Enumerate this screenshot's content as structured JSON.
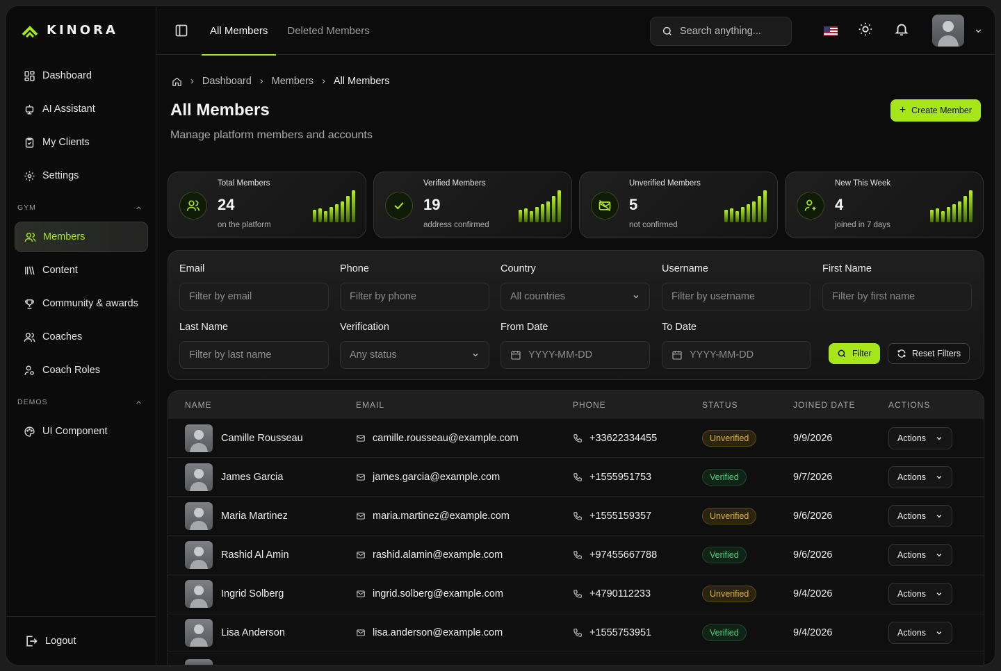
{
  "brand": {
    "name": "KINORA",
    "accent": "#a7e619"
  },
  "sidebar": {
    "items_top": [
      {
        "label": "Dashboard",
        "icon": "dashboard-icon"
      },
      {
        "label": "AI Assistant",
        "icon": "robot-icon"
      },
      {
        "label": "My Clients",
        "icon": "clipboard-icon"
      },
      {
        "label": "Settings",
        "icon": "gear-icon"
      }
    ],
    "section_gym": "GYM",
    "items_gym": [
      {
        "label": "Members",
        "icon": "users-icon",
        "active": true
      },
      {
        "label": "Content",
        "icon": "library-icon"
      },
      {
        "label": "Community & awards",
        "icon": "trophy-icon"
      },
      {
        "label": "Coaches",
        "icon": "users-icon"
      },
      {
        "label": "Coach Roles",
        "icon": "user-cog-icon"
      }
    ],
    "section_demos": "DEMOS",
    "items_demos": [
      {
        "label": "UI Component",
        "icon": "palette-icon"
      }
    ],
    "logout": "Logout"
  },
  "topbar": {
    "tabs": [
      "All Members",
      "Deleted Members"
    ],
    "search_placeholder": "Search anything..."
  },
  "breadcrumb": [
    "Dashboard",
    "Members",
    "All Members"
  ],
  "page": {
    "title": "All Members",
    "subtitle": "Manage platform members and accounts",
    "create_label": "Create Member"
  },
  "stats": [
    {
      "label": "Total Members",
      "value": "24",
      "caption": "on the platform",
      "icon": "users-icon"
    },
    {
      "label": "Verified Members",
      "value": "19",
      "caption": "address confirmed",
      "icon": "check-icon"
    },
    {
      "label": "Unverified Members",
      "value": "5",
      "caption": "not confirmed",
      "icon": "mail-off-icon"
    },
    {
      "label": "New This Week",
      "value": "4",
      "caption": "joined in 7 days",
      "icon": "user-plus-icon"
    }
  ],
  "filters": {
    "email": {
      "label": "Email",
      "placeholder": "Filter by email"
    },
    "phone": {
      "label": "Phone",
      "placeholder": "Filter by phone"
    },
    "country": {
      "label": "Country",
      "value": "All countries"
    },
    "username": {
      "label": "Username",
      "placeholder": "Filter by username"
    },
    "first_name": {
      "label": "First Name",
      "placeholder": "Filter by first name"
    },
    "last_name": {
      "label": "Last Name",
      "placeholder": "Filter by last name"
    },
    "verification": {
      "label": "Verification",
      "value": "Any status"
    },
    "from_date": {
      "label": "From Date",
      "placeholder": "YYYY-MM-DD"
    },
    "to_date": {
      "label": "To Date",
      "placeholder": "YYYY-MM-DD"
    },
    "filter_label": "Filter",
    "reset_label": "Reset Filters"
  },
  "table": {
    "headers": [
      "NAME",
      "EMAIL",
      "PHONE",
      "STATUS",
      "JOINED DATE",
      "ACTIONS"
    ],
    "actions_label": "Actions",
    "rows": [
      {
        "name": "Camille Rousseau",
        "email": "camille.rousseau@example.com",
        "phone": "+33622334455",
        "status": "Unverified",
        "joined": "9/9/2026"
      },
      {
        "name": "James Garcia",
        "email": "james.garcia@example.com",
        "phone": "+1555951753",
        "status": "Verified",
        "joined": "9/7/2026"
      },
      {
        "name": "Maria Martinez",
        "email": "maria.martinez@example.com",
        "phone": "+1555159357",
        "status": "Unverified",
        "joined": "9/6/2026"
      },
      {
        "name": "Rashid Al Amin",
        "email": "rashid.alamin@example.com",
        "phone": "+97455667788",
        "status": "Verified",
        "joined": "9/6/2026"
      },
      {
        "name": "Ingrid Solberg",
        "email": "ingrid.solberg@example.com",
        "phone": "+4790112233",
        "status": "Unverified",
        "joined": "9/4/2026"
      },
      {
        "name": "Lisa Anderson",
        "email": "lisa.anderson@example.com",
        "phone": "+1555753951",
        "status": "Verified",
        "joined": "9/4/2026"
      }
    ]
  }
}
